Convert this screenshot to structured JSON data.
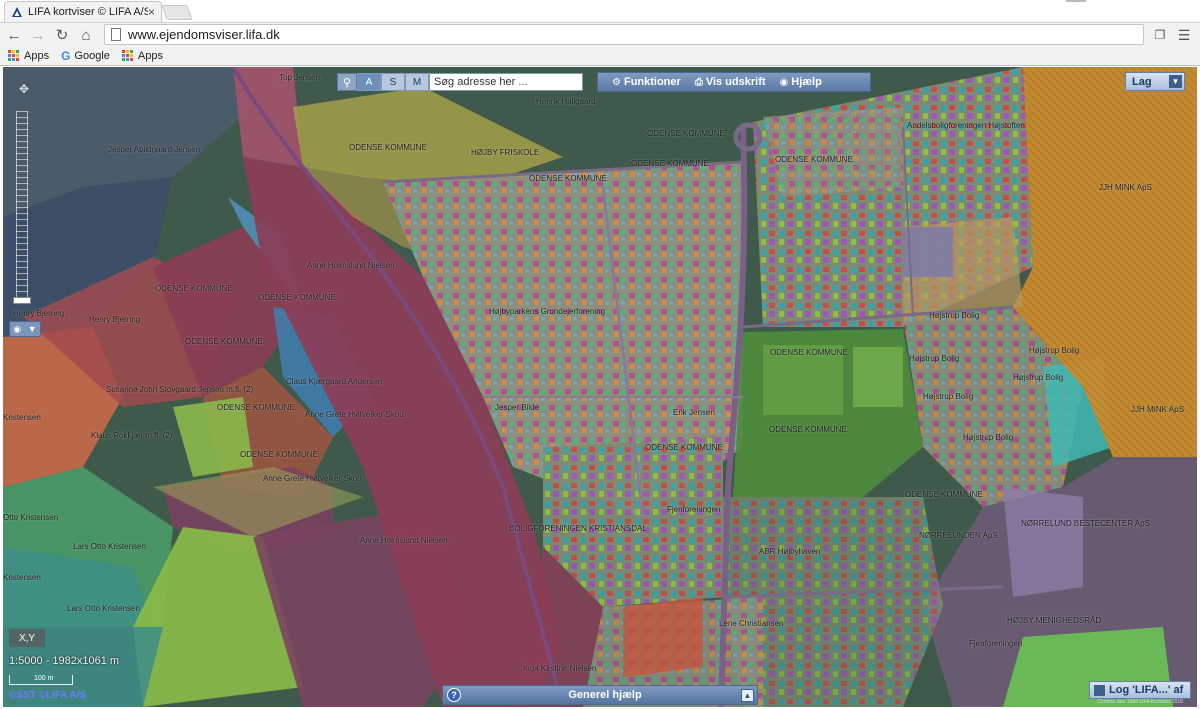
{
  "browser": {
    "tab_title": "LIFA kortviser © LIFA A/S",
    "tab_close": "×",
    "url": "www.ejendomsviser.lifa.dk",
    "bookmarks": [
      {
        "label": "Apps"
      },
      {
        "label": "Google"
      },
      {
        "label": "Apps"
      }
    ]
  },
  "map_toolbar": {
    "search_icon": "magnifier-icon",
    "modes": [
      "A",
      "S",
      "M"
    ],
    "active_mode": "A",
    "search_placeholder": "Søg adresse her ...",
    "menu": [
      {
        "label": "Funktioner",
        "icon": "tools-icon"
      },
      {
        "label": "Vis udskrift",
        "icon": "print-icon"
      },
      {
        "label": "Hjælp",
        "icon": "help-lifebuoy-icon"
      }
    ],
    "layers_label": "Lag"
  },
  "map_controls": {
    "xy_label": "X,Y",
    "scale_text": "1:5000 - 1982x1061 m",
    "scalebar_label": "100 m",
    "copyright": "©SST ©LIFA A/S",
    "help_panel_label": "Generel hjælp",
    "help_icon": "?",
    "log_label": "Log 'LIFA...' af",
    "footer_small": "Chrome ikke 1994 LIFA Kortviser 2016"
  },
  "map_labels": [
    {
      "text": "Top Jensen"
    },
    {
      "text": "Jesper Abildgaard Jensen"
    },
    {
      "text": "ODENSE KOMMUNE"
    },
    {
      "text": "Henrik Hallgaard"
    },
    {
      "text": "HØJBY FRISKOLE"
    },
    {
      "text": "ODENSE KOMMUNE"
    },
    {
      "text": "ODENSE KOMMUNE"
    },
    {
      "text": "ODENSE KOMMUNE"
    },
    {
      "text": "ODENSE KOMMUNE"
    },
    {
      "text": "Andelsboligforeningen Højstoften"
    },
    {
      "text": "JJH MINK ApS"
    },
    {
      "text": "Anne Holmslund Nielsen"
    },
    {
      "text": "ODENSE KOMMUNE"
    },
    {
      "text": "ODENSE KOMMUNE"
    },
    {
      "text": "Henry Bjerring"
    },
    {
      "text": "Henry Bjerring"
    },
    {
      "text": "Højbyparkens Grundejerforening"
    },
    {
      "text": "ODENSE KOMMUNE"
    },
    {
      "text": "Susanne John Stovgaard Jensen m.fl. (2)"
    },
    {
      "text": "Claus Kjærgaard Andersen"
    },
    {
      "text": "ODENSE KOMMUNE"
    },
    {
      "text": "Anne Grete Hvitveiker Skou"
    },
    {
      "text": "Klaus Rokkjær m.fl. (2)"
    },
    {
      "text": "ODENSE KOMMUNE"
    },
    {
      "text": "Anne Grete Hvitveiker Skou"
    },
    {
      "text": "Kristensen"
    },
    {
      "text": "Jesper Bilde"
    },
    {
      "text": "Erik Jensen"
    },
    {
      "text": "ODENSE KOMMUNE"
    },
    {
      "text": "ODENSE KOMMUNE"
    },
    {
      "text": "ODENSE KOMMUNE"
    },
    {
      "text": "Højstrup Bolig"
    },
    {
      "text": "Højstrup Bolig"
    },
    {
      "text": "Højstrup Bolig"
    },
    {
      "text": "Højstrup Bolig"
    },
    {
      "text": "Højstrup Bolig"
    },
    {
      "text": "Højstrup Bolig"
    },
    {
      "text": "JJH MINK ApS"
    },
    {
      "text": "Otto Kristensen"
    },
    {
      "text": "Lars Otto Kristensen"
    },
    {
      "text": "Kristensen"
    },
    {
      "text": "Lars Otto Kristensen"
    },
    {
      "text": "BOLIGFORENINGEN KRISTIANSDAL"
    },
    {
      "text": "Anne Holmslund Nielsen"
    },
    {
      "text": "Fjenforeningen"
    },
    {
      "text": "ABR Højbyhaven"
    },
    {
      "text": "NØRRELUNDEN ApS"
    },
    {
      "text": "NØRRELUND BESTECENTER ApS"
    },
    {
      "text": "ODENSE KOMMUNE"
    },
    {
      "text": "Lene Christiansen"
    },
    {
      "text": "Inga Kirstine Nielsen"
    },
    {
      "text": "HØJBY MENIGHEDSRÅD"
    },
    {
      "text": "Fjenforeningen"
    }
  ]
}
